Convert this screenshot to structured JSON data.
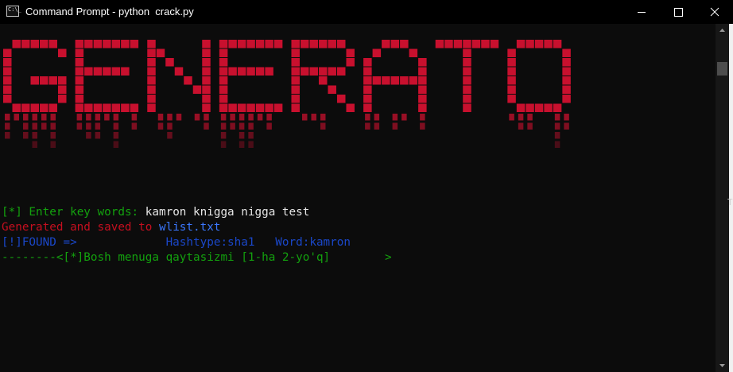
{
  "window": {
    "title": "Command Prompt - python  crack.py",
    "icon_text": "C:\\_",
    "controls": [
      "minimize-icon",
      "maximize-icon",
      "close-icon"
    ]
  },
  "banner": {
    "text": "GENERATOR",
    "color": "#c8102e"
  },
  "console": {
    "prompt_marker": "[*]",
    "prompt_label": " Enter key words: ",
    "prompt_input": "kamron knigga nigga test",
    "generated_msg": "Generated and saved to ",
    "generated_file": "wlist.txt",
    "found_line": "[!]FOUND =>             Hashtype:sha1   Word:kamron",
    "menu_line": "--------<[*]Bosh menuga qaytasizmi [1-ha 2-yo'q]        >"
  },
  "colors": {
    "green": "#13a10e",
    "red": "#c50f1f",
    "blue": "#3b78ff",
    "white": "#e6e6e6",
    "background": "#0c0c0c"
  }
}
